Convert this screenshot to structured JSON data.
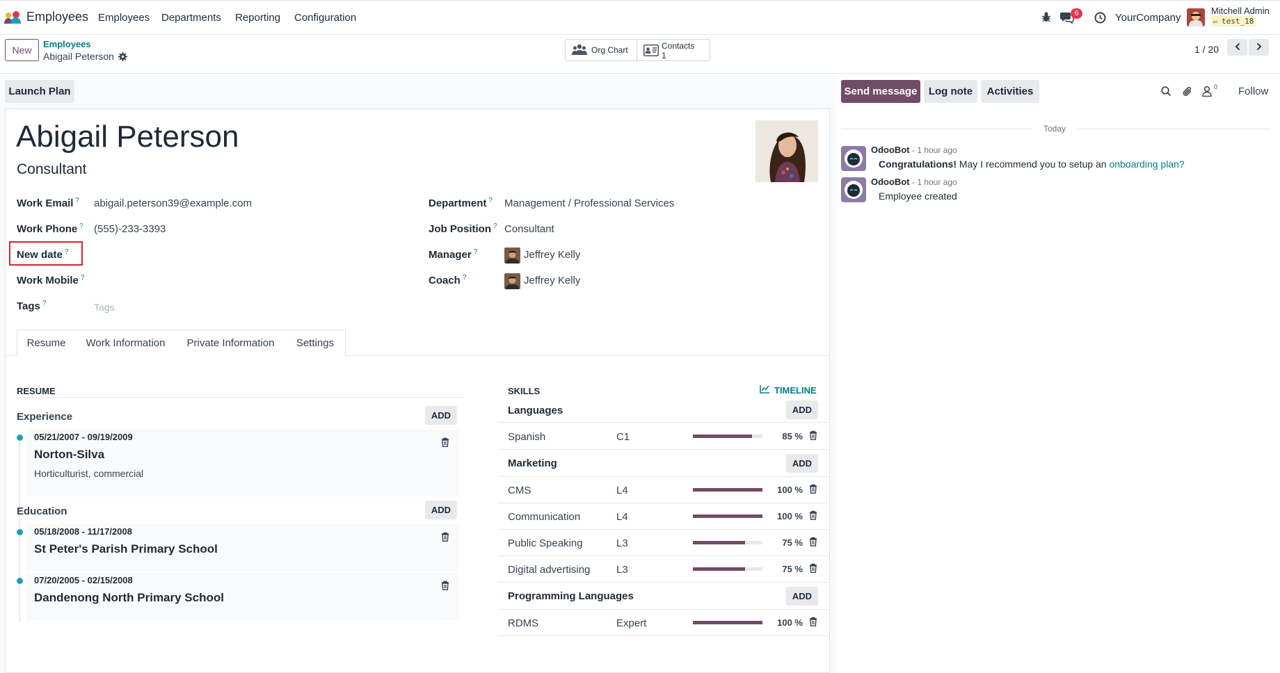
{
  "navbar": {
    "app_name": "Employees",
    "menu": [
      "Employees",
      "Departments",
      "Reporting",
      "Configuration"
    ],
    "chat_badge": "6",
    "company": "YourCompany",
    "user_name": "Mitchell Admin",
    "db_name": "test_18"
  },
  "control": {
    "new_label": "New",
    "breadcrumb_parent": "Employees",
    "breadcrumb_current": "Abigail Peterson",
    "org_chart_label": "Org Chart",
    "contacts_label": "Contacts",
    "contacts_count": "1",
    "pager": "1 / 20"
  },
  "actions": {
    "launch_plan": "Launch Plan"
  },
  "employee": {
    "name": "Abigail Peterson",
    "job_title": "Consultant",
    "fields_left": [
      {
        "label": "Work Email",
        "value": "abigail.peterson39@example.com"
      },
      {
        "label": "Work Phone",
        "value": "(555)-233-3393"
      },
      {
        "label": "New date",
        "value": ""
      },
      {
        "label": "Work Mobile",
        "value": ""
      },
      {
        "label": "Tags",
        "value": "",
        "placeholder": "Tags"
      }
    ],
    "fields_right": [
      {
        "label": "Department",
        "value": "Management / Professional Services"
      },
      {
        "label": "Job Position",
        "value": "Consultant"
      },
      {
        "label": "Manager",
        "value": "Jeffrey Kelly"
      },
      {
        "label": "Coach",
        "value": "Jeffrey Kelly"
      }
    ],
    "help_mark": "?"
  },
  "tabs": [
    "Resume",
    "Work Information",
    "Private Information",
    "Settings"
  ],
  "resume": {
    "title": "RESUME",
    "add_label": "ADD",
    "experience_title": "Experience",
    "education_title": "Education",
    "experience": [
      {
        "dates": "05/21/2007 - 09/19/2009",
        "name": "Norton-Silva",
        "desc": "Horticulturist, commercial"
      }
    ],
    "education": [
      {
        "dates": "05/18/2008 - 11/17/2008",
        "name": "St Peter's Parish Primary School"
      },
      {
        "dates": "07/20/2005 - 02/15/2008",
        "name": "Dandenong North Primary School"
      }
    ]
  },
  "skills": {
    "title": "SKILLS",
    "timeline_label": "TIMELINE",
    "add_label": "ADD",
    "categories": [
      {
        "name": "Languages",
        "items": [
          {
            "name": "Spanish",
            "level": "C1",
            "progress": 85,
            "pct": "85 %"
          }
        ]
      },
      {
        "name": "Marketing",
        "items": [
          {
            "name": "CMS",
            "level": "L4",
            "progress": 100,
            "pct": "100 %"
          },
          {
            "name": "Communication",
            "level": "L4",
            "progress": 100,
            "pct": "100 %"
          },
          {
            "name": "Public Speaking",
            "level": "L3",
            "progress": 75,
            "pct": "75 %"
          },
          {
            "name": "Digital advertising",
            "level": "L3",
            "progress": 75,
            "pct": "75 %"
          }
        ]
      },
      {
        "name": "Programming Languages",
        "items": [
          {
            "name": "RDMS",
            "level": "Expert",
            "progress": 100,
            "pct": "100 %"
          }
        ]
      }
    ]
  },
  "chatter": {
    "send_message": "Send message",
    "log_note": "Log note",
    "activities": "Activities",
    "followers_count": "0",
    "follow": "Follow",
    "date_sep": "Today",
    "messages": [
      {
        "author": "OdooBot",
        "time": "- 1 hour ago",
        "bold": "Congratulations!",
        "text": " May I recommend you to setup an ",
        "link": "onboarding plan?"
      },
      {
        "author": "OdooBot",
        "time": "- 1 hour ago",
        "text": "Employee created"
      }
    ]
  },
  "colors": {
    "brand": "#714b67",
    "accent": "#017e84",
    "highlight": "#d9232d",
    "badge": "#e4364f"
  }
}
